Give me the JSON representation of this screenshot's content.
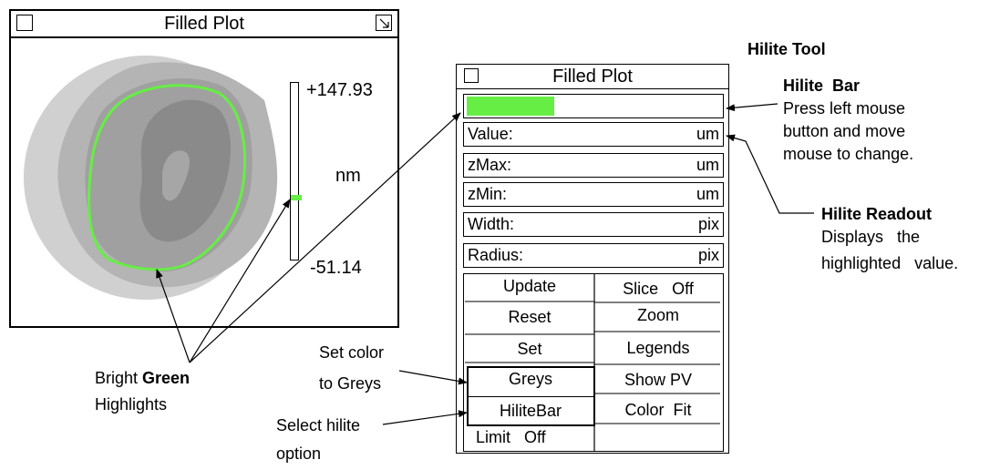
{
  "left_window": {
    "title": "Filled Plot",
    "scale_max": "+147.93",
    "scale_unit": "nm",
    "scale_min": "-51.14"
  },
  "right_window": {
    "title": "Filled  Plot",
    "fields": [
      {
        "label": "Value:",
        "unit": "um"
      },
      {
        "label": "zMax:",
        "unit": "um"
      },
      {
        "label": "zMin:",
        "unit": "um"
      },
      {
        "label": "Width:",
        "unit": "pix"
      },
      {
        "label": "Radius:",
        "unit": "pix"
      }
    ],
    "buttons_left": [
      "Update",
      "Reset",
      "Set",
      "Greys",
      "HiliteBar",
      "Limit   Off"
    ],
    "buttons_right": [
      "Slice   Off",
      "Zoom",
      "Legends",
      "Show PV",
      "Color  Fit",
      ""
    ]
  },
  "annotations": {
    "hilite_tool": "Hilite Tool",
    "hilite_bar_title": "Hilite  Bar",
    "hilite_bar_desc": [
      "Press left mouse",
      "button and move",
      "mouse to change."
    ],
    "hilite_readout_title": "Hilite Readout",
    "hilite_readout_desc": [
      "Displays   the",
      "highlighted   value."
    ],
    "set_color": [
      "Set color",
      "to Greys"
    ],
    "select_hilite": [
      "Select hilite",
      "option"
    ],
    "bright_prefix": "Bright ",
    "bright_green": "Green",
    "highlights": "Highlights"
  },
  "colors": {
    "highlight_green": "#66ee44",
    "grey_light": "#d0d0d0",
    "grey_mid": "#b4b4b4",
    "grey_mid2": "#a0a0a0",
    "grey_dark": "#8a8a8a"
  }
}
